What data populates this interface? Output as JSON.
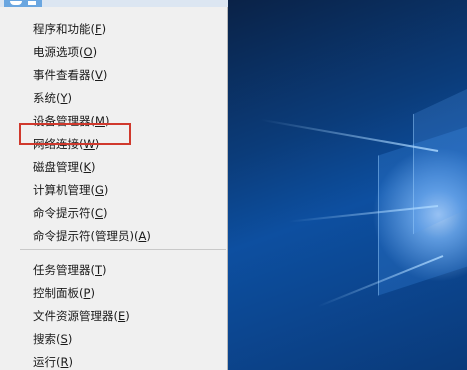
{
  "menu": {
    "items": [
      {
        "label": "程序和功能",
        "accel": "F",
        "name": "menu-item-programs-features"
      },
      {
        "label": "电源选项",
        "accel": "O",
        "name": "menu-item-power-options"
      },
      {
        "label": "事件查看器",
        "accel": "V",
        "name": "menu-item-event-viewer"
      },
      {
        "label": "系统",
        "accel": "Y",
        "name": "menu-item-system"
      },
      {
        "label": "设备管理器",
        "accel": "M",
        "name": "menu-item-device-manager"
      },
      {
        "label": "网络连接",
        "accel": "W",
        "name": "menu-item-network-connections"
      },
      {
        "label": "磁盘管理",
        "accel": "K",
        "name": "menu-item-disk-management"
      },
      {
        "label": "计算机管理",
        "accel": "G",
        "name": "menu-item-computer-management"
      },
      {
        "label": "命令提示符",
        "accel": "C",
        "name": "menu-item-command-prompt"
      },
      {
        "label": "命令提示符(管理员)",
        "accel": "A",
        "name": "menu-item-command-prompt-admin"
      },
      {
        "label": "任务管理器",
        "accel": "T",
        "name": "menu-item-task-manager"
      },
      {
        "label": "控制面板",
        "accel": "P",
        "name": "menu-item-control-panel"
      },
      {
        "label": "文件资源管理器",
        "accel": "E",
        "name": "menu-item-file-explorer"
      },
      {
        "label": "搜索",
        "accel": "S",
        "name": "menu-item-search"
      },
      {
        "label": "运行",
        "accel": "R",
        "name": "menu-item-run"
      }
    ],
    "highlighted_item": "设备管理器(M)",
    "highlight_color": "#d0392d"
  }
}
